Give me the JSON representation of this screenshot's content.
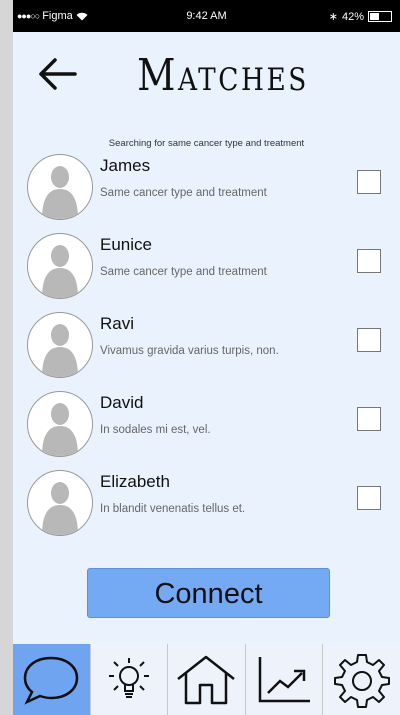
{
  "status_bar": {
    "carrier": "Figma",
    "time": "9:42 AM",
    "battery": "42%"
  },
  "header": {
    "back_icon": "arrow-left-icon",
    "title": "Matches",
    "subtitle": "Searching for same cancer type and treatment"
  },
  "matches": [
    {
      "name": "James",
      "description": "Same cancer type and treatment",
      "checked": false
    },
    {
      "name": "Eunice",
      "description": "Same cancer type and treatment",
      "checked": false
    },
    {
      "name": "Ravi",
      "description": "Vivamus gravida varius turpis, non.",
      "checked": false
    },
    {
      "name": "David",
      "description": "In sodales mi est, vel.",
      "checked": false
    },
    {
      "name": "Elizabeth",
      "description": "In blandit venenatis tellus et.",
      "checked": false
    }
  ],
  "connect_label": "Connect",
  "tab_bar": {
    "active_index": 0,
    "tabs": [
      {
        "icon": "chat-bubble-icon"
      },
      {
        "icon": "lightbulb-icon"
      },
      {
        "icon": "home-icon"
      },
      {
        "icon": "trend-chart-icon"
      },
      {
        "icon": "gear-icon"
      }
    ]
  },
  "colors": {
    "background": "#eaf2fd",
    "accent": "#74a9f4",
    "active_tab": "#6fa5f0"
  }
}
